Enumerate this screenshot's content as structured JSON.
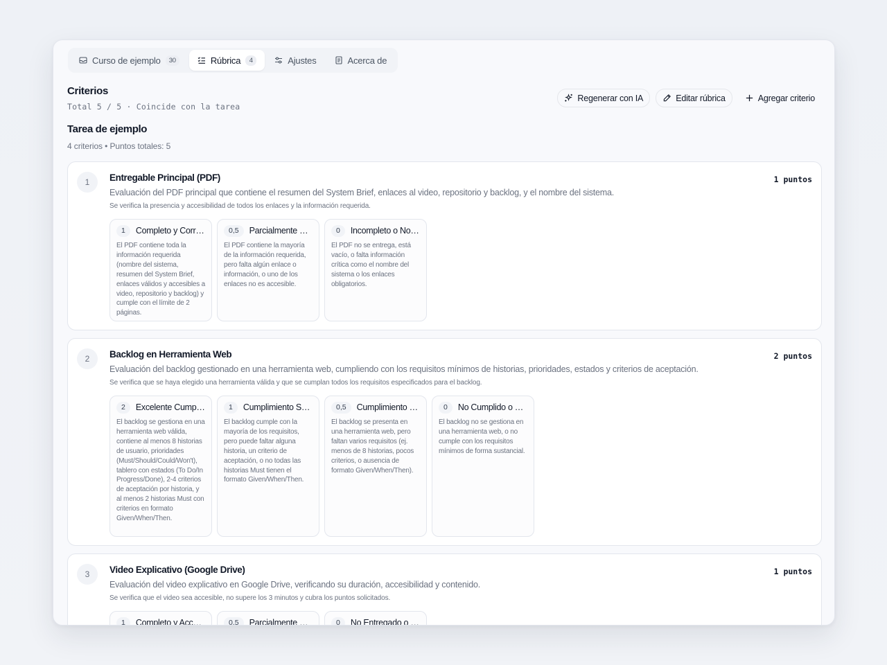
{
  "tabs": [
    {
      "label": "Curso de ejemplo",
      "badge": "30",
      "icon": "inbox-icon"
    },
    {
      "label": "Rúbrica",
      "badge": "4",
      "icon": "checklist-icon"
    },
    {
      "label": "Ajustes",
      "icon": "sliders-icon"
    },
    {
      "label": "Acerca de",
      "icon": "document-icon"
    }
  ],
  "section": {
    "title": "Criterios",
    "subtitle": "Total 5 / 5 · Coincide con la tarea"
  },
  "actions": {
    "regenerate": "Regenerar con IA",
    "edit": "Editar rúbrica",
    "add": "Agregar criterio"
  },
  "task": {
    "title": "Tarea de ejemplo",
    "meta": "4 criterios • Puntos totales: 5"
  },
  "criteria": [
    {
      "number": "1",
      "title": "Entregable Principal (PDF)",
      "points": "1 puntos",
      "description": "Evaluación del PDF principal que contiene el resumen del System Brief, enlaces al video, repositorio y backlog, y el nombre del sistema.",
      "note": "Se verifica la presencia y accesibilidad de todos los enlaces y la información requerida.",
      "levels": [
        {
          "score": "1",
          "name": "Completo y Correcto",
          "description": "El PDF contiene toda la información requerida (nombre del sistema, resumen del System Brief, enlaces válidos y accesibles a video, repositorio y backlog) y cumple con el límite de 2 páginas."
        },
        {
          "score": "0,5",
          "name": "Parcialmente Completo",
          "description": "El PDF contiene la mayoría de la información requerida, pero falta algún enlace o información, o uno de los enlaces no es accesible."
        },
        {
          "score": "0",
          "name": "Incompleto o No Entregado",
          "description": "El PDF no se entrega, está vacío, o falta información crítica como el nombre del sistema o los enlaces obligatorios."
        }
      ]
    },
    {
      "number": "2",
      "title": "Backlog en Herramienta Web",
      "points": "2 puntos",
      "description": "Evaluación del backlog gestionado en una herramienta web, cumpliendo con los requisitos mínimos de historias, prioridades, estados y criterios de aceptación.",
      "note": "Se verifica que se haya elegido una herramienta válida y que se cumplan todos los requisitos especificados para el backlog.",
      "levels": [
        {
          "score": "2",
          "name": "Excelente Cumplimiento",
          "description": "El backlog se gestiona en una herramienta web válida, contiene al menos 8 historias de usuario, prioridades (Must/Should/Could/Won't), tablero con estados (To Do/In Progress/Done), 2-4 criterios de aceptación por historia, y al menos 2 historias Must con criterios en formato Given/When/Then."
        },
        {
          "score": "1",
          "name": "Cumplimiento Suficiente",
          "description": "El backlog cumple con la mayoría de los requisitos, pero puede faltar alguna historia, un criterio de aceptación, o no todas las historias Must tienen el formato Given/When/Then."
        },
        {
          "score": "0,5",
          "name": "Cumplimiento Parcial",
          "description": "El backlog se presenta en una herramienta web, pero faltan varios requisitos (ej. menos de 8 historias, pocos criterios, o ausencia de formato Given/When/Then)."
        },
        {
          "score": "0",
          "name": "No Cumplido o No Entregado",
          "description": "El backlog no se gestiona en una herramienta web, o no cumple con los requisitos mínimos de forma sustancial."
        }
      ]
    },
    {
      "number": "3",
      "title": "Video Explicativo (Google Drive)",
      "points": "1 puntos",
      "description": "Evaluación del video explicativo en Google Drive, verificando su duración, accesibilidad y contenido.",
      "note": "Se verifica que el video sea accesible, no supere los 3 minutos y cubra los puntos solicitados.",
      "levels": [
        {
          "score": "1",
          "name": "Completo y Accesible",
          "description": ""
        },
        {
          "score": "0,5",
          "name": "Parcialmente Completo",
          "description": ""
        },
        {
          "score": "0",
          "name": "No Entregado o No Accesible",
          "description": ""
        }
      ]
    }
  ]
}
